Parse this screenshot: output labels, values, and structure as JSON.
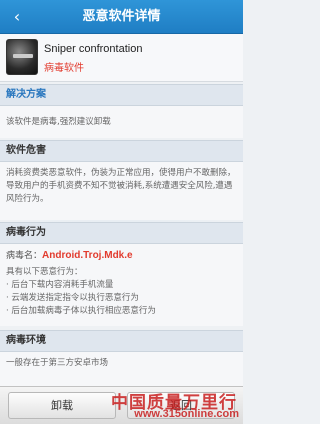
{
  "title_bar": {
    "title": "恶意软件详情"
  },
  "app": {
    "name": "Sniper confrontation",
    "tag": "病毒软件"
  },
  "solution": {
    "heading": "解决方案",
    "text": "该软件是病毒,强烈建议卸载"
  },
  "harm": {
    "heading": "软件危害",
    "text": "消耗资费类恶意软件，伪装为正常应用，使得用户不敢删除，导致用户的手机资费不知不觉被消耗,系统遭遇安全风险,遭遇风险行为。"
  },
  "behavior": {
    "heading": "病毒行为",
    "name_label": "病毒名：",
    "virus_name": "Android.Troj.Mdk.e",
    "intro": "具有以下恶意行为：",
    "items": [
      "· 后台下载内容消耗手机流量",
      "· 云端发送指定指令以执行恶意行为",
      "· 后台加载病毒子体以执行相应恶意行为"
    ]
  },
  "environment": {
    "heading": "病毒环境",
    "text": "一般存在于第三方安卓市场"
  },
  "buttons": {
    "uninstall": "卸载",
    "back": "返回"
  },
  "watermark": {
    "cn": "中国质量万里行",
    "url": "www.315online.com"
  },
  "colors": {
    "title_bar": "#2688cf",
    "section_head_text": "#2b78bf",
    "virus_red": "#e23b2e"
  }
}
